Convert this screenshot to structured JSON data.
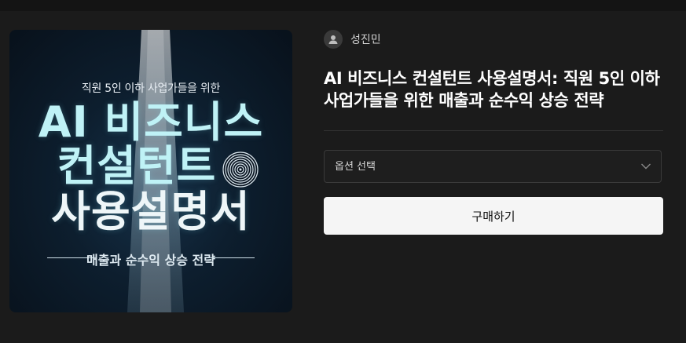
{
  "cover": {
    "subtitle": "직원 5인 이하 사업가들을 위한",
    "title_line1": "AI 비즈니스",
    "title_line2": "컨설턴트",
    "title_line3": "사용설명서",
    "tagline": "매출과 순수익 상승 전략",
    "accent_color": "#bff2f6"
  },
  "author": {
    "name": "성진민",
    "avatar_icon": "avatar-icon"
  },
  "product": {
    "title": "AI 비즈니스 컨설턴트 사용설명서: 직원 5인 이하 사업가들을 위한 매출과 순수익 상승 전략"
  },
  "option_select": {
    "label": "옵션 선택",
    "icon": "chevron-down-icon"
  },
  "buy_button": {
    "label": "구매하기"
  }
}
